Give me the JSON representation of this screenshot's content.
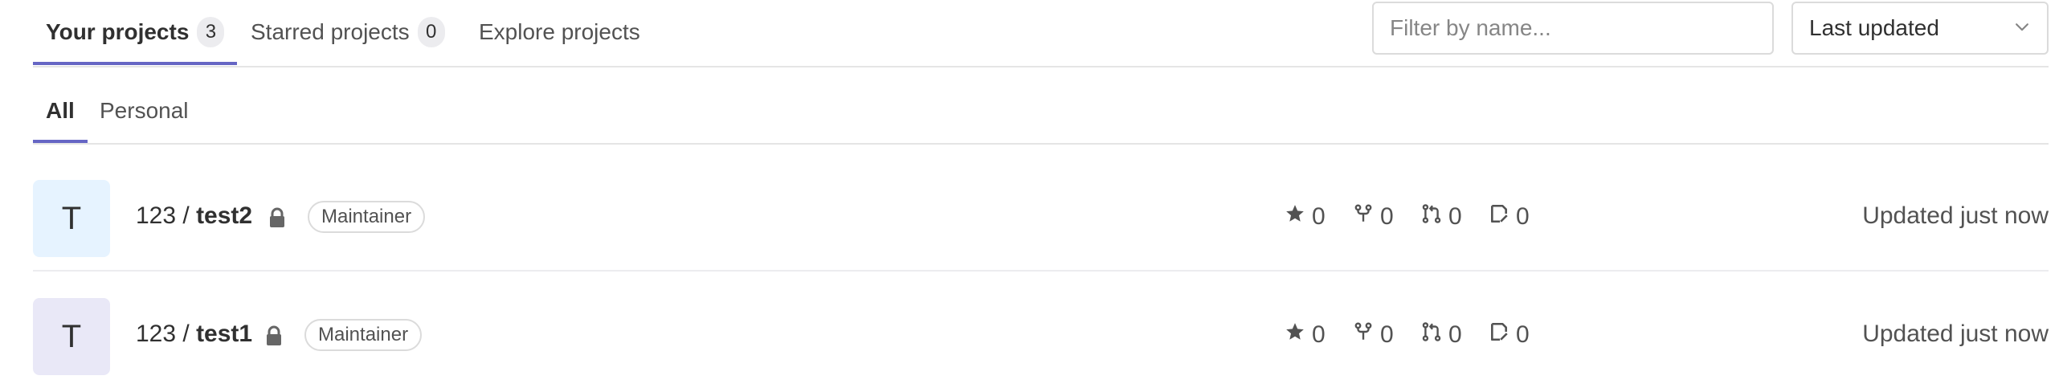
{
  "tabs": [
    {
      "label": "Your projects",
      "count": "3",
      "active": true
    },
    {
      "label": "Starred projects",
      "count": "0",
      "active": false
    },
    {
      "label": "Explore projects",
      "active": false
    }
  ],
  "filter": {
    "placeholder": "Filter by name..."
  },
  "sort": {
    "selected": "Last updated"
  },
  "subtabs": [
    {
      "label": "All",
      "active": true
    },
    {
      "label": "Personal",
      "active": false
    }
  ],
  "projects": [
    {
      "avatar_letter": "T",
      "avatar_color": "#e6f3ff",
      "namespace": "123 / ",
      "name": "test2",
      "role": "Maintainer",
      "stars": "0",
      "forks": "0",
      "merge_requests": "0",
      "issues": "0",
      "updated": "Updated just now"
    },
    {
      "avatar_letter": "T",
      "avatar_color": "#e9e8f7",
      "namespace": "123 / ",
      "name": "test1",
      "role": "Maintainer",
      "stars": "0",
      "forks": "0",
      "merge_requests": "0",
      "issues": "0",
      "updated": "Updated just now"
    }
  ],
  "colors": {
    "accent": "#6666c4",
    "border": "#dbdbdb",
    "text": "#303030",
    "muted": "#525252"
  },
  "icons": [
    "lock-icon",
    "star-icon",
    "fork-icon",
    "merge-request-icon",
    "issues-icon",
    "chevron-down-icon"
  ]
}
